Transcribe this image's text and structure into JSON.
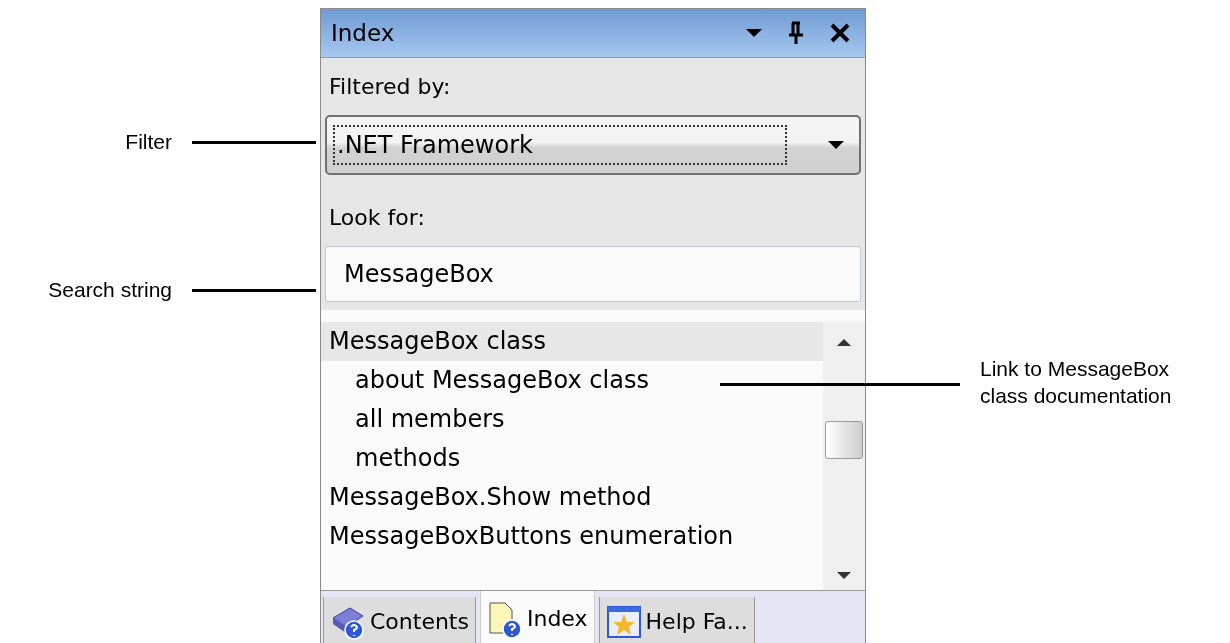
{
  "panel": {
    "title": "Index",
    "filter": {
      "label": "Filtered by:",
      "value": ".NET Framework"
    },
    "search": {
      "label": "Look for:",
      "value": "MessageBox"
    },
    "index_items": [
      {
        "label": "MessageBox class",
        "selected": true,
        "children": [
          {
            "label": "about MessageBox class",
            "selected": false
          },
          {
            "label": "all members",
            "selected": false
          },
          {
            "label": "methods",
            "selected": false
          }
        ]
      },
      {
        "label": "MessageBox.Show method",
        "selected": false
      },
      {
        "label": "MessageBoxButtons enumeration",
        "selected": false
      }
    ],
    "tabs": [
      {
        "label": "Contents",
        "kind": "book",
        "selected": false
      },
      {
        "label": "Index",
        "kind": "page",
        "selected": true
      },
      {
        "label": "Help Fa...",
        "kind": "star",
        "selected": false
      }
    ]
  },
  "annotations": [
    {
      "text": "Filter",
      "kind": "left"
    },
    {
      "text": "Search string",
      "kind": "left"
    },
    {
      "text": "Link to MessageBox class documentation",
      "kind": "right"
    }
  ]
}
